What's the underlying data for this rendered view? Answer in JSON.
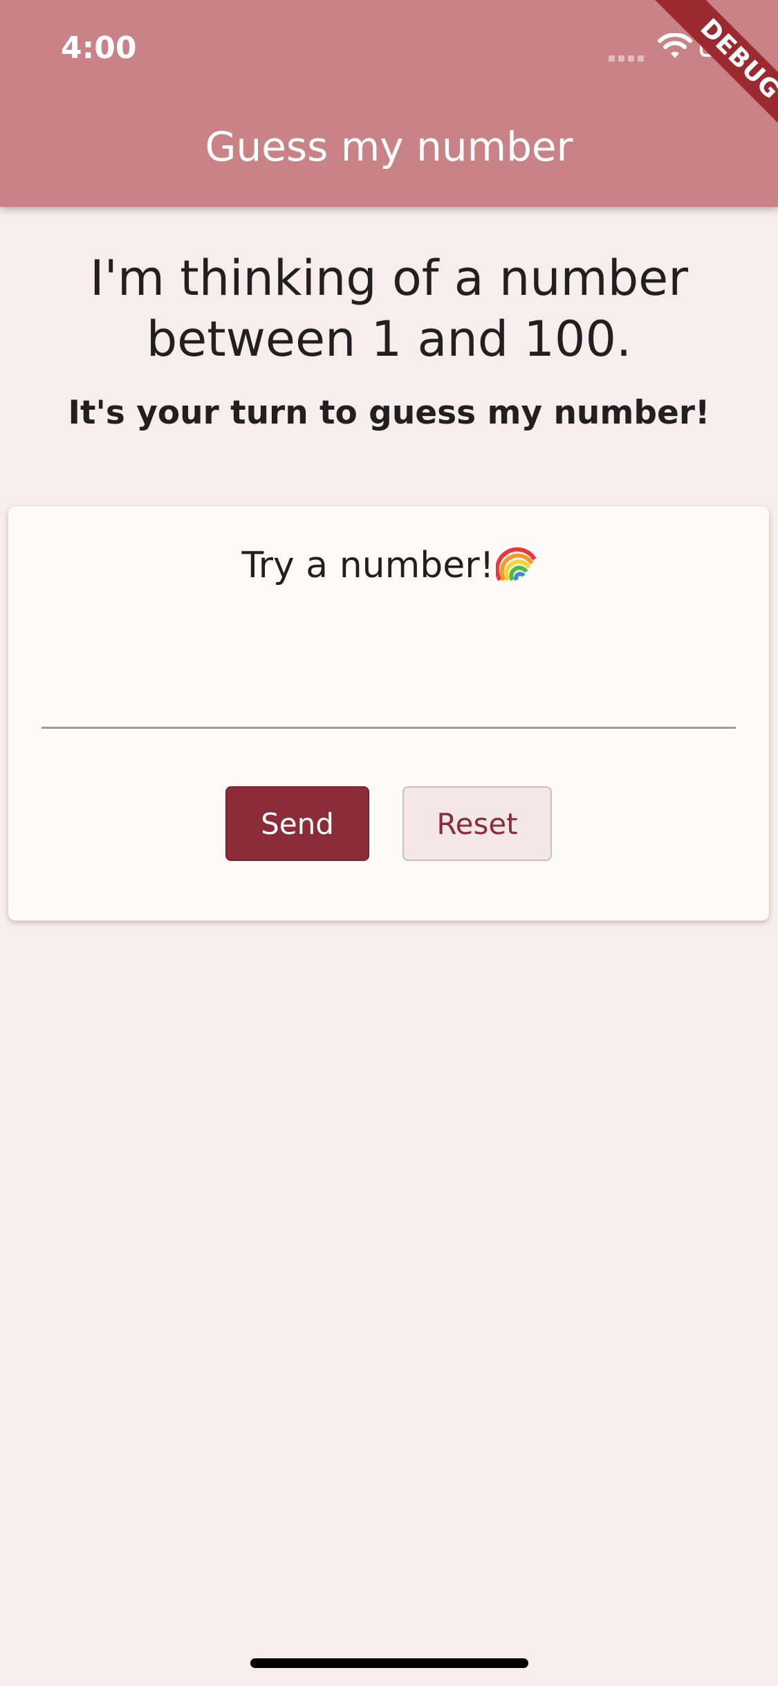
{
  "status_bar": {
    "time": "4:00"
  },
  "debug_banner": {
    "label": "DEBUG"
  },
  "app_bar": {
    "title": "Guess my number"
  },
  "main": {
    "intro": "I'm thinking of a number between 1 and 100.",
    "subtitle": "It's your turn to guess my number!"
  },
  "card": {
    "title": "Try a number!",
    "input_value": "",
    "send_label": "Send",
    "reset_label": "Reset"
  },
  "colors": {
    "app_bar": "#c98387",
    "background": "#f7eded",
    "primary": "#8c2c38",
    "card": "#fffafa"
  },
  "icons": {
    "title_emoji": "rainbow-icon"
  }
}
